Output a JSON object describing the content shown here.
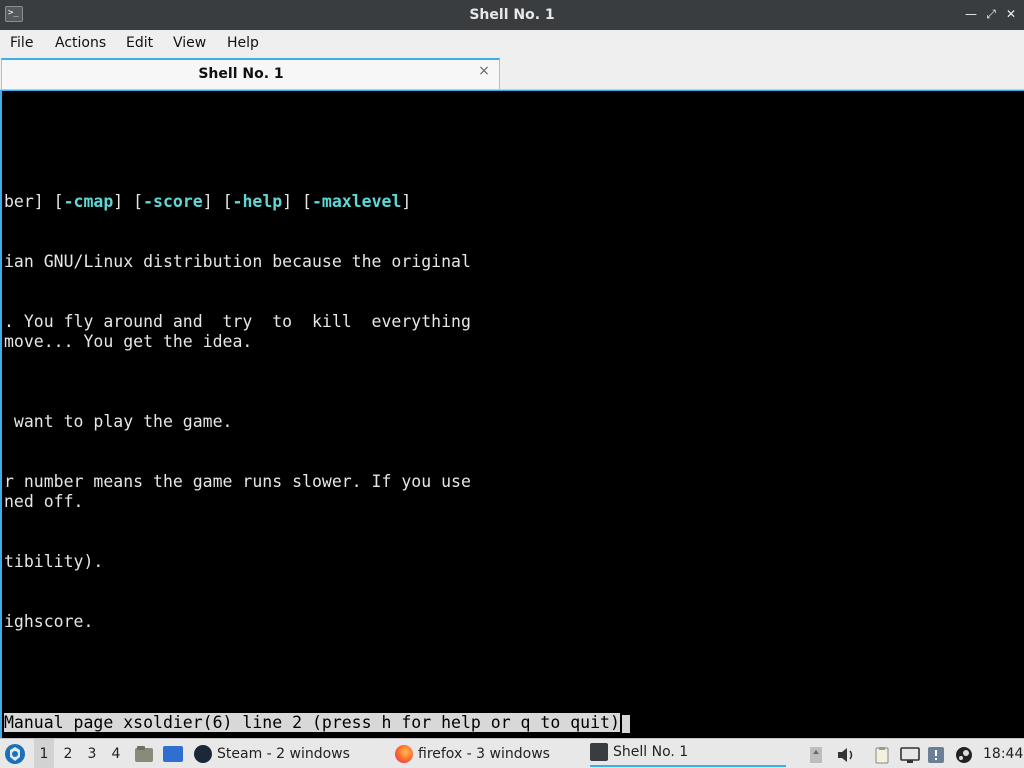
{
  "window": {
    "title": "Shell No. 1",
    "icon": "terminal-icon"
  },
  "menu": [
    "File",
    "Actions",
    "Edit",
    "View",
    "Help"
  ],
  "tab": {
    "label": "Shell No. 1",
    "close_glyph": "×"
  },
  "terminal": {
    "lines": [
      {
        "pre": "ber] [",
        "opts": [
          {
            "text": "-cmap",
            "after": "] ["
          },
          {
            "text": "-score",
            "after": "] ["
          },
          {
            "text": "-help",
            "after": "] ["
          },
          {
            "text": "-maxlevel",
            "after": "]"
          }
        ]
      },
      {
        "text": "ian GNU/Linux distribution because the original"
      },
      {
        "text": ". You fly around and  try  to  kill  everything"
      },
      {
        "text": "move... You get the idea."
      },
      {
        "text": " want to play the game."
      },
      {
        "text": "r number means the game runs slower. If you use"
      },
      {
        "text": "ned off."
      },
      {
        "text": "tibility)."
      },
      {
        "text": "ighscore."
      }
    ],
    "status": "Manual page xsoldier(6) line 2 (press h for help or q to quit)"
  },
  "taskbar": {
    "workspaces": [
      "1",
      "2",
      "3",
      "4"
    ],
    "tasks": [
      {
        "label": "Steam - 2 windows",
        "icon": "steam-icon"
      },
      {
        "label": "firefox - 3 windows",
        "icon": "firefox-icon"
      },
      {
        "label": "Shell No. 1",
        "icon": "terminal-icon"
      }
    ],
    "clock": "18:44"
  },
  "colors": {
    "accent": "#3daee9",
    "option_highlight": "#5fd7d7",
    "terminal_bg": "#000000",
    "titlebar_bg": "#3a3d40"
  }
}
